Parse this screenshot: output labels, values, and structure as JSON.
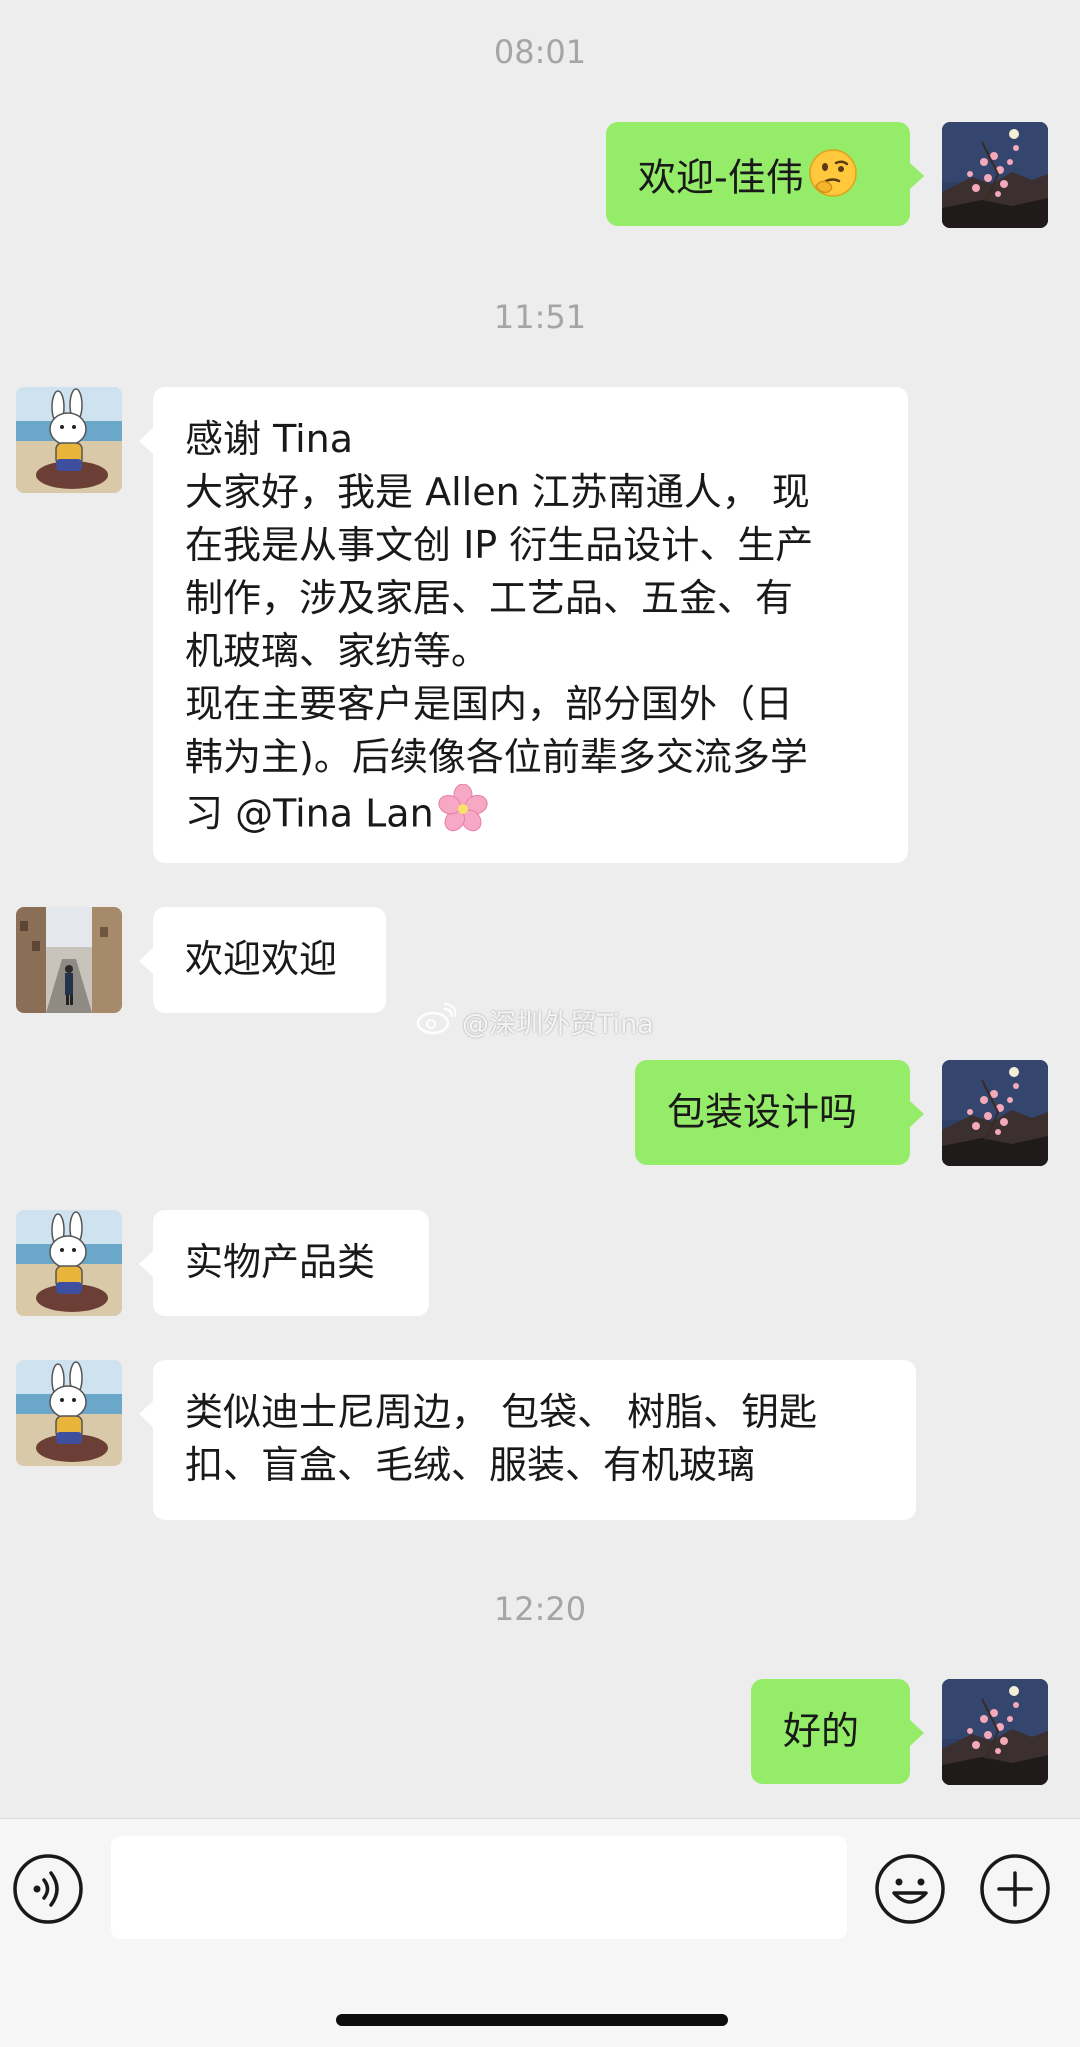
{
  "timestamps": [
    "08:01",
    "11:51",
    "12:20"
  ],
  "messages": {
    "m1": {
      "text": "欢迎-佳伟",
      "emoji": "thinking-face-emoji"
    },
    "m2": {
      "lines": [
        "感谢 Tina",
        "大家好，我是 Allen 江苏南通人，  现",
        "在我是从事文创 IP 衍生品设计、生产",
        "制作，涉及家居、工艺品、五金、有",
        "机玻璃、家纺等。",
        "现在主要客户是国内，部分国外（日",
        "韩为主)。后续像各位前辈多交流多学",
        "习 @Tina Lan"
      ],
      "emoji": "cherry-blossom-emoji"
    },
    "m3": {
      "text": "欢迎欢迎"
    },
    "m4": {
      "text": "包装设计吗"
    },
    "m5": {
      "text": "实物产品类"
    },
    "m6": {
      "lines": [
        "类似迪士尼周边， 包袋、 树脂、钥匙",
        "扣、盲盒、毛绒、服装、有机玻璃"
      ]
    },
    "m7": {
      "text": "好的"
    }
  },
  "watermark": {
    "text": "@深圳外贸Tina",
    "icon": "weibo-icon"
  },
  "input_bar": {
    "placeholder": "",
    "voice_icon": "voice-icon",
    "emoji_icon": "emoji-icon",
    "plus_icon": "plus-icon"
  },
  "colors": {
    "background": "#ededed",
    "incoming_bubble": "#ffffff",
    "outgoing_bubble": "#95ec69",
    "timestamp": "#a5a5a5",
    "text": "#191919"
  }
}
